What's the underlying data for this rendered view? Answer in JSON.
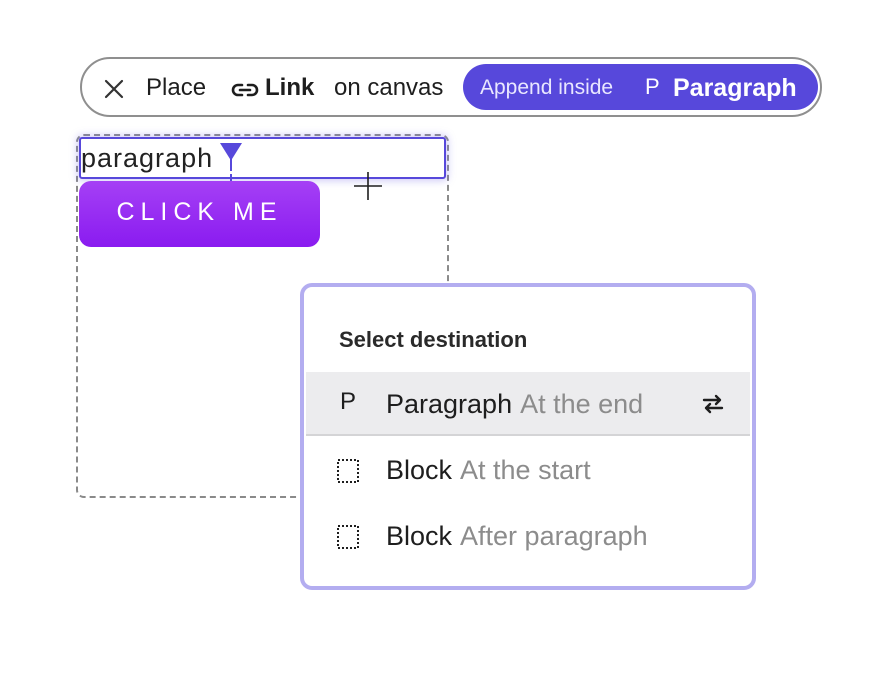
{
  "toolbar": {
    "place_label": "Place",
    "link_label": "Link",
    "on_canvas_label": "on canvas",
    "append_inside_label": "Append inside",
    "paragraph_icon_glyph": "P",
    "paragraph_label": "Paragraph",
    "accent_color": "#5748db"
  },
  "canvas": {
    "paragraph_text": "paragraph",
    "button_label": "CLICK ME",
    "button_color": "#9b30f3"
  },
  "destination_popup": {
    "title": "Select destination",
    "options": [
      {
        "icon": "paragraph-icon",
        "icon_glyph": "P",
        "name": "Paragraph",
        "detail": "At the end",
        "selected": true,
        "trailing_icon": "swap-arrows-icon"
      },
      {
        "icon": "block-icon",
        "name": "Block",
        "detail": "At the start",
        "selected": false
      },
      {
        "icon": "block-icon",
        "name": "Block",
        "detail": "After paragraph",
        "selected": false
      }
    ]
  }
}
